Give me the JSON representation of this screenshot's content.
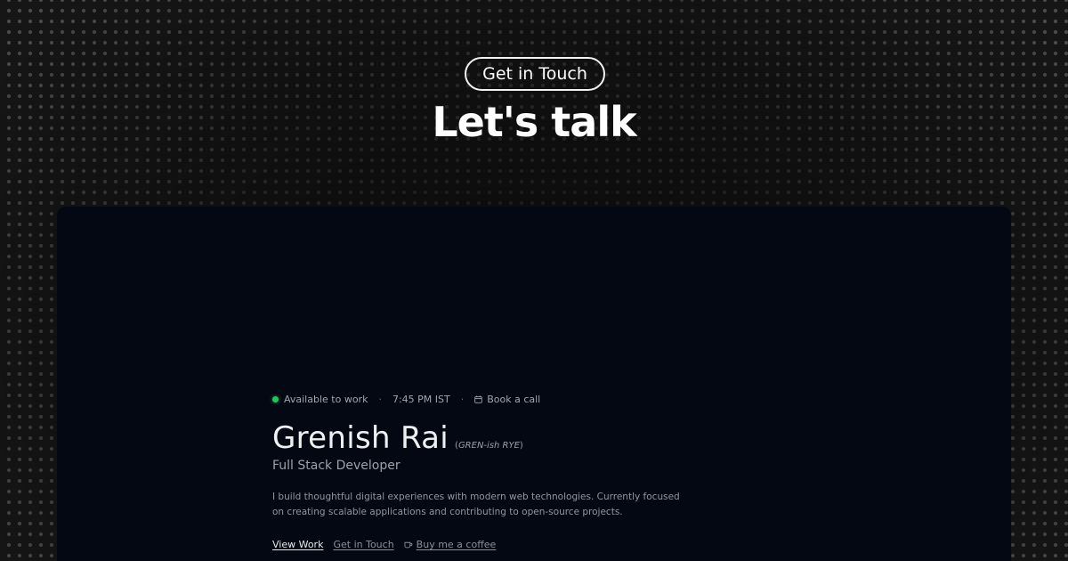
{
  "header": {
    "pill_label": "Get in Touch",
    "headline": "Let's talk"
  },
  "card": {
    "status": {
      "availability": "Available to work",
      "separator": "·",
      "local_time": "7:45 PM IST",
      "book_call_label": "Book a call",
      "availability_color": "#22c55e"
    },
    "profile": {
      "name": "Grenish Rai",
      "pronunciation_open": "(",
      "pronunciation": "GREN-ish RYE",
      "pronunciation_close": ")",
      "role": "Full Stack Developer",
      "bio": "I build thoughtful digital experiences with modern web technologies. Currently focused on creating scalable applications and contributing to open-source projects."
    },
    "links": {
      "view_work": "View Work",
      "get_in_touch": "Get in Touch",
      "buy_coffee": "Buy me a coffee"
    },
    "icons": {
      "book_call": "calendar-icon",
      "buy_coffee": "coffee-cup-icon"
    }
  }
}
